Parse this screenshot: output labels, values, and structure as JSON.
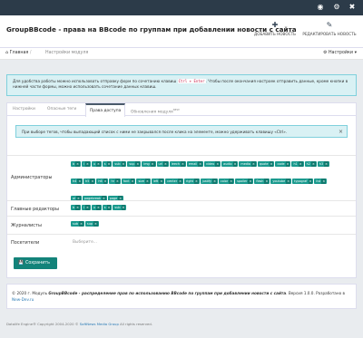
{
  "topbar": {
    "icons": [
      "globe-icon",
      "gear-icon",
      "close-icon"
    ]
  },
  "header": {
    "title": "GroupBBcode - права на BBcode по группам при добавлении новости с сайта",
    "btn_add": "ДОБАВИТЬ НОВОСТЬ",
    "btn_edit": "РЕДАКТИРОВАТЬ НОВОСТЬ"
  },
  "crumbs": {
    "home": "Главная",
    "sep": "/",
    "current": "Настройки модуля",
    "settings": "Настройки"
  },
  "info": {
    "text1": "Для удобства работы можно использовать отправку форм по сочетанию клавиш",
    "code": "Ctrl + Enter",
    "text2": ". Чтобы после окончания настроек отправить данные, кроме кнопки в нижней части формы, можно использовать сочетание данных клавиш."
  },
  "tabs": [
    {
      "label": "Настройки"
    },
    {
      "label": "Опасные теги"
    },
    {
      "label": "Права доступа"
    },
    {
      "label": "Обновления модуля",
      "badge": "NEW"
    }
  ],
  "alert": {
    "text": "При выборе тегов, чтобы выпадающий список с ними не закрывался после клика на элементе, можно удерживать клавишу «Ctrl».",
    "close": "×"
  },
  "rows": {
    "admins": {
      "label": "Администраторы",
      "tags": [
        "b",
        "i",
        "u",
        "s",
        "sub",
        "sup",
        "img",
        "url",
        "leech",
        "email",
        "video",
        "audio",
        "media",
        "quote",
        "code",
        "h1",
        "h2",
        "h3",
        "h4",
        "h5",
        "h6",
        "hr",
        "font",
        "size",
        "left",
        "center",
        "right",
        "justify",
        "color",
        "spoiler",
        "flash",
        "youtube",
        "typograf",
        "list",
        "ol",
        "pagebreak",
        "page"
      ]
    },
    "editors": {
      "label": "Главные редакторы",
      "tags": [
        "b",
        "i",
        "u",
        "s",
        "sub"
      ]
    },
    "journalists": {
      "label": "Журналисты",
      "tags": [
        "sub",
        "sup"
      ]
    },
    "visitors": {
      "label": "Посетители",
      "placeholder": "Выберите..."
    }
  },
  "save": {
    "label": "Сохранить"
  },
  "footer": {
    "copy": "© 2020 г. Модуль ",
    "module": "GroupBBcode - распределение прав по использованию BBcode по группам при добавлении новости с сайта",
    "version": ". Версия 1.0.0",
    "dev": ". Разработано в",
    "dev_link": "New-Dev.ru"
  },
  "bottom": {
    "text": "Datalife Engine® Copyright 2004-2020 © ",
    "link": "SoftNews Media Group",
    "rights": " All rights reserved."
  }
}
